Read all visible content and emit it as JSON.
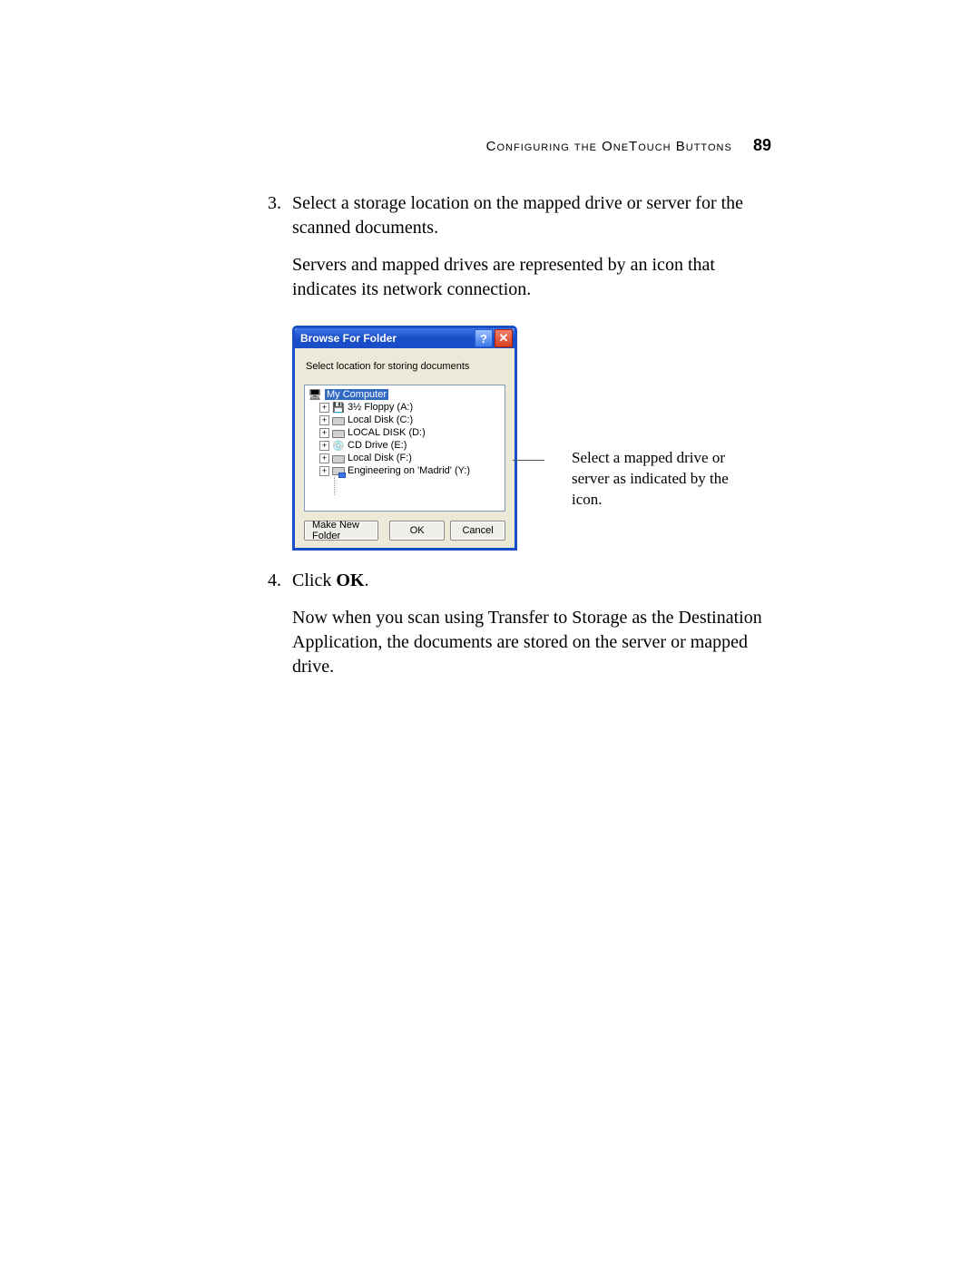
{
  "header": {
    "section_title": "Configuring the OneTouch Buttons",
    "page_number": "89"
  },
  "steps": {
    "s3": {
      "number": "3.",
      "para1": "Select a storage location on the mapped drive or server for the scanned documents.",
      "para2": "Servers and mapped drives are represented by an icon that indicates its network connection."
    },
    "s4": {
      "number": "4.",
      "para1_prefix": "Click ",
      "para1_bold": "OK",
      "para1_suffix": ".",
      "para2": "Now when you scan using Transfer to Storage as the Destination Application, the documents are stored on the server or mapped drive."
    }
  },
  "dialog": {
    "title": "Browse For Folder",
    "help_glyph": "?",
    "close_glyph": "✕",
    "instruction": "Select location for storing documents",
    "tree": {
      "root": "My Computer",
      "items": [
        {
          "label": "3½ Floppy (A:)",
          "icon": "floppy"
        },
        {
          "label": "Local Disk (C:)",
          "icon": "disk"
        },
        {
          "label": "LOCAL DISK (D:)",
          "icon": "disk"
        },
        {
          "label": "CD Drive (E:)",
          "icon": "cd"
        },
        {
          "label": "Local Disk (F:)",
          "icon": "disk"
        },
        {
          "label": "Engineering on 'Madrid' (Y:)",
          "icon": "net"
        }
      ]
    },
    "buttons": {
      "new_folder": "Make New Folder",
      "ok": "OK",
      "cancel": "Cancel"
    }
  },
  "callout": "Select a mapped drive or server as indicated by the icon."
}
